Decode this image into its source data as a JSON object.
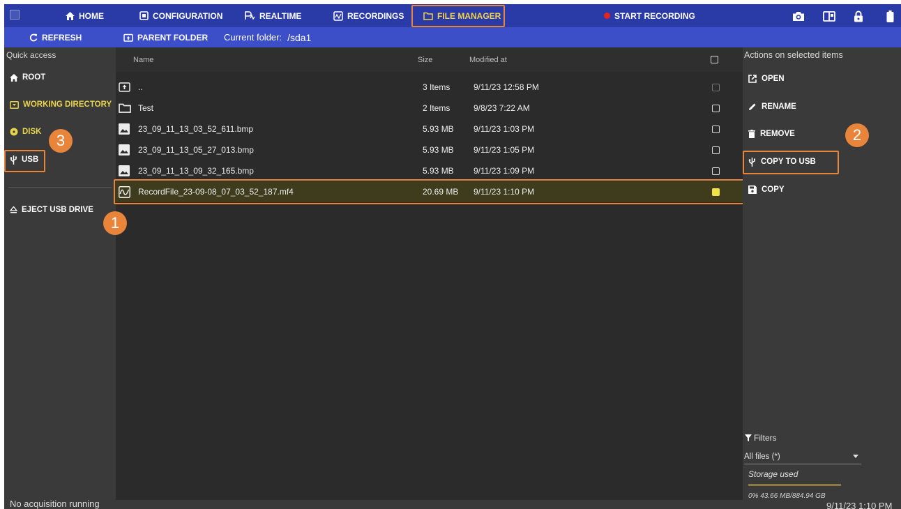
{
  "colors": {
    "nav_bg": "#2a3aa6",
    "subbar_bg": "#3c4ec8",
    "accent_yellow": "#f5d24a",
    "highlight": "#e8853a",
    "record_red": "#e8231d"
  },
  "nav": {
    "home": "HOME",
    "configuration": "CONFIGURATION",
    "realtime": "REALTIME",
    "recordings": "RECORDINGS",
    "file_manager": "FILE MANAGER",
    "start_recording": "START RECORDING"
  },
  "toolbar": {
    "refresh": "REFRESH",
    "parent_folder": "PARENT FOLDER",
    "current_folder_label": "Current folder:",
    "current_folder_value": "/sda1"
  },
  "quick_access": {
    "title": "Quick access",
    "root": "ROOT",
    "working_directory": "WORKING DIRECTORY",
    "disk": "DISK",
    "usb": "USB",
    "eject": "EJECT USB DRIVE"
  },
  "columns": {
    "name": "Name",
    "size": "Size",
    "modified": "Modified at"
  },
  "files": [
    {
      "name": "..",
      "size": "3 Items",
      "modified": "9/11/23 12:58 PM",
      "icon": "parent-folder-icon",
      "checked": false
    },
    {
      "name": "Test",
      "size": "2 Items",
      "modified": "9/8/23 7:22 AM",
      "icon": "folder-icon",
      "checked": false
    },
    {
      "name": "23_09_11_13_03_52_611.bmp",
      "size": "5.93 MB",
      "modified": "9/11/23 1:03 PM",
      "icon": "image-icon",
      "checked": false
    },
    {
      "name": "23_09_11_13_05_27_013.bmp",
      "size": "5.93 MB",
      "modified": "9/11/23 1:05 PM",
      "icon": "image-icon",
      "checked": false
    },
    {
      "name": "23_09_11_13_09_32_165.bmp",
      "size": "5.93 MB",
      "modified": "9/11/23 1:09 PM",
      "icon": "image-icon",
      "checked": false
    },
    {
      "name": "RecordFile_23-09-08_07_03_52_187.mf4",
      "size": "20.69 MB",
      "modified": "9/11/23 1:10 PM",
      "icon": "waveform-icon",
      "checked": true
    }
  ],
  "actions": {
    "title": "Actions on selected items",
    "open": "OPEN",
    "rename": "RENAME",
    "remove": "REMOVE",
    "copy_to_usb": "COPY TO USB",
    "copy": "COPY"
  },
  "filters": {
    "label": "Filters",
    "selected": "All files (*)"
  },
  "storage": {
    "label": "Storage used",
    "text": "0% 43.66 MB/884.94 GB",
    "fraction": 0.0
  },
  "status": {
    "acquisition": "No acquisition running",
    "datetime": "9/11/23 1:10 PM"
  },
  "callouts": {
    "one": "1",
    "two": "2",
    "three": "3"
  }
}
